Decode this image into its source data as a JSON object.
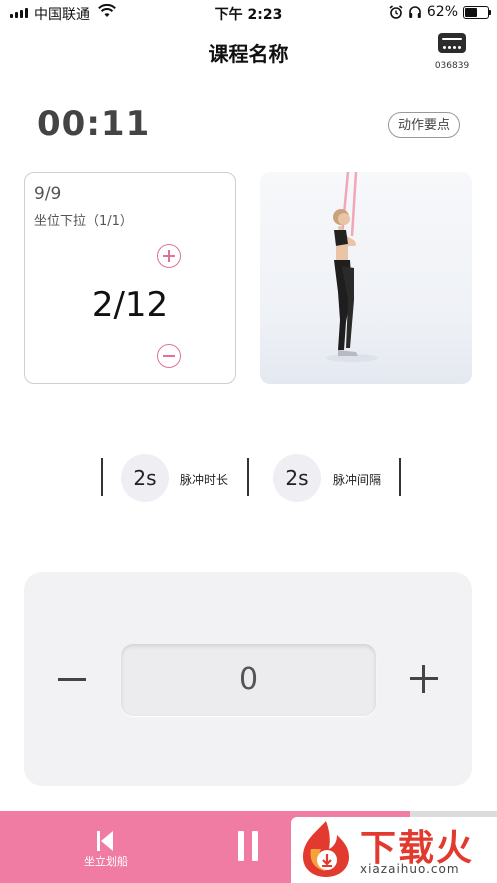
{
  "status_bar": {
    "carrier": "中国联通",
    "time": "下午 2:23",
    "battery": "62%",
    "battery_level": 0.62
  },
  "header": {
    "title": "课程名称",
    "device_code": "036839"
  },
  "timer": {
    "elapsed": "00:11",
    "tips_label": "动作要点"
  },
  "exercise": {
    "set_progress": "9/9",
    "name": "坐位下拉（1/1）",
    "rep_progress": "2/12"
  },
  "pulse": {
    "duration_value": "2s",
    "duration_label": "脉冲时长",
    "interval_value": "2s",
    "interval_label": "脉冲间隔"
  },
  "control": {
    "value": "0"
  },
  "bottom_bar": {
    "prev_label": "坐立划船",
    "accent_color": "#f07ba3"
  },
  "watermark": {
    "text": "下载火",
    "url": "xiazaihuo.com"
  }
}
